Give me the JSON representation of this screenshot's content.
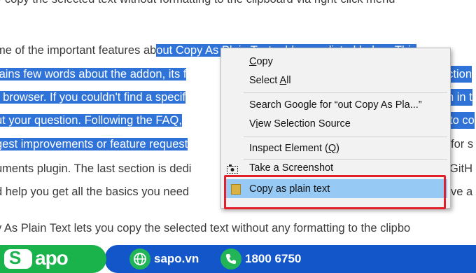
{
  "document": {
    "lines": [
      {
        "plain": "y copy the selected text without formatting to the clipboard via right-click menu",
        "sel": ""
      },
      {
        "plain": "me of the important features ab",
        "sel": "out Copy As Plain Text addon, as listed below. This"
      },
      {
        "plain": "",
        "sel": "tains few words about the addon, its f",
        "tail": "ection"
      },
      {
        "plain": "",
        "sel": "r browser. If you couldn't find a specif",
        "tail": "h in t"
      },
      {
        "plain": "",
        "sel": "ut your question. Following the FAQ, ",
        "tail": "to co"
      },
      {
        "plain": "",
        "sel": "gest improvements or feature request",
        "tail2": "for s"
      },
      {
        "plain": "uments plugin. The last section is dedi",
        "sel": "",
        "tail3": "GitH"
      },
      {
        "plain": "d help you get all the basics you need",
        "sel": "",
        "tail3": "ve a"
      },
      {
        "plain": "y As Plain Text lets you copy the selected text without any formatting to the clipbo",
        "sel": ""
      }
    ]
  },
  "context_menu": {
    "items": [
      {
        "label": "Copy",
        "underline": "C"
      },
      {
        "label": "Select All",
        "underline": "A"
      },
      {
        "label": "Search Google for “out Copy As Pla...”",
        "underline": "S"
      },
      {
        "label": "View Selection Source",
        "underline": "e"
      },
      {
        "label": "Inspect Element (Q)",
        "underline": "Q"
      },
      {
        "label": "Take a Screenshot",
        "underline": ""
      },
      {
        "label": "Copy as plain text",
        "underline": ""
      }
    ],
    "highlight_color": "#97c9f5",
    "annotation_color": "#e2202c"
  },
  "footer": {
    "brand": "Sapo",
    "website": "sapo.vn",
    "phone": "1800 6750",
    "brand_color": "#1ab24b",
    "bar_color": "#1356c9"
  }
}
